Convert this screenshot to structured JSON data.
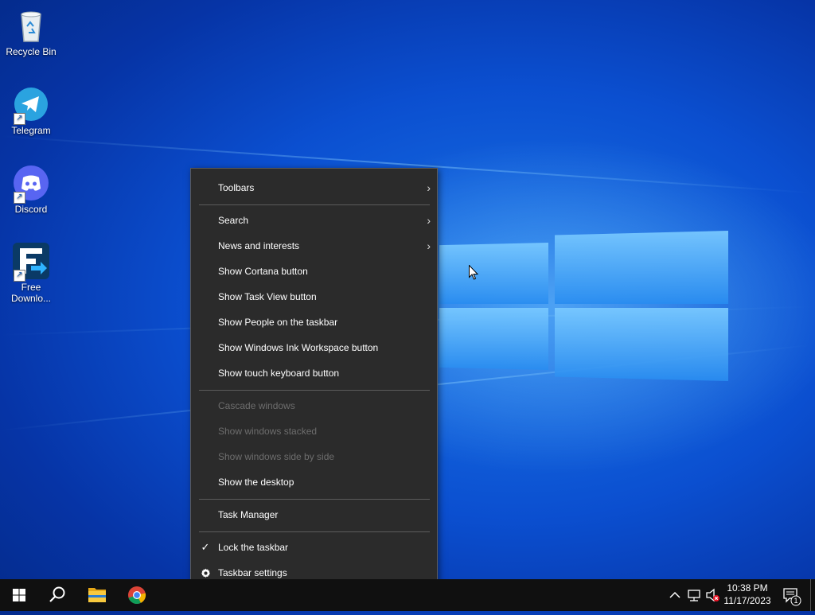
{
  "desktop": {
    "icons": [
      {
        "label": "Recycle Bin",
        "icon": "recycle-bin-icon"
      },
      {
        "label": "Telegram",
        "icon": "telegram-icon"
      },
      {
        "label": "Discord",
        "icon": "discord-icon"
      },
      {
        "label_line1": "Free",
        "label_line2": "Downlo...",
        "icon": "free-download-manager-icon"
      }
    ]
  },
  "context_menu": {
    "items": [
      {
        "label": "Toolbars",
        "submenu": true
      },
      {
        "label": "Search",
        "submenu": true
      },
      {
        "label": "News and interests",
        "submenu": true
      },
      {
        "label": "Show Cortana button"
      },
      {
        "label": "Show Task View button"
      },
      {
        "label": "Show People on the taskbar"
      },
      {
        "label": "Show Windows Ink Workspace button"
      },
      {
        "label": "Show touch keyboard button"
      },
      {
        "label": "Cascade windows",
        "disabled": true
      },
      {
        "label": "Show windows stacked",
        "disabled": true
      },
      {
        "label": "Show windows side by side",
        "disabled": true
      },
      {
        "label": "Show the desktop"
      },
      {
        "label": "Task Manager"
      },
      {
        "label": "Lock the taskbar",
        "checked": true
      },
      {
        "label": "Taskbar settings",
        "icon": "gear-icon"
      }
    ],
    "chevron": "›",
    "check": "✓"
  },
  "taskbar": {
    "time": "10:38 PM",
    "date": "11/17/2023",
    "notification_count": "1",
    "pinned": [
      "start-icon",
      "search-icon",
      "file-explorer-icon",
      "chrome-icon"
    ]
  },
  "colors": {
    "menu_bg": "#2b2b2b",
    "disabled_text": "#6d6d6d",
    "taskbar_bg": "#101010"
  }
}
